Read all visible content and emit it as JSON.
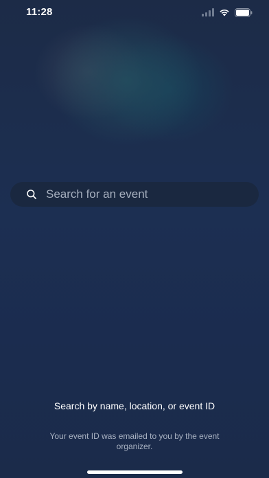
{
  "status_bar": {
    "time": "11:28",
    "icons": [
      "cellular-signal-icon",
      "wifi-icon",
      "battery-icon"
    ]
  },
  "search": {
    "placeholder": "Search for an event",
    "value": "",
    "icon": "search-icon"
  },
  "hint": {
    "title": "Search by name, location, or event ID",
    "subtitle": "Your event ID was emailed to you by the event organizer."
  },
  "colors": {
    "background": "#1c2d4d",
    "text_primary": "#ffffff",
    "text_secondary": "#a8b1c1",
    "search_field": "#1a2840"
  }
}
